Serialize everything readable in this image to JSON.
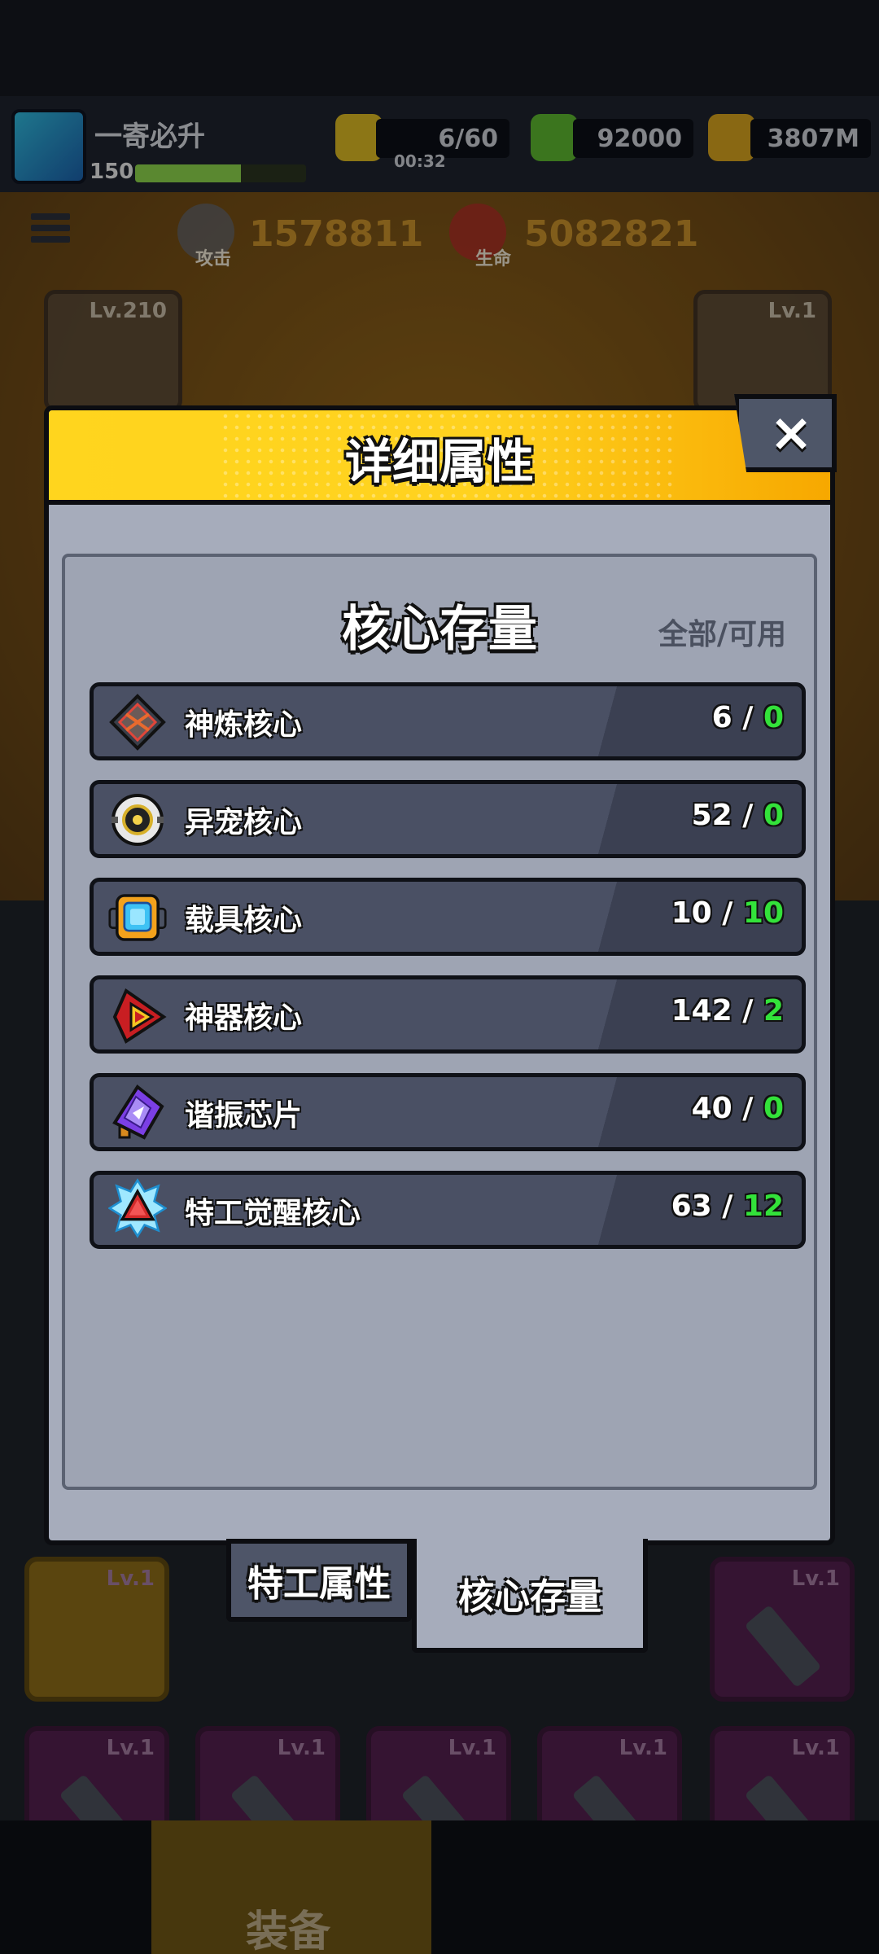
{
  "player": {
    "name": "一寄必升",
    "level": "150"
  },
  "resources": {
    "energy": "6/60",
    "energy_timer": "00:32",
    "gems": "92000",
    "gold": "3807M"
  },
  "stats": {
    "attack_label": "攻击",
    "attack_value": "1578811",
    "life_label": "生命",
    "life_value": "5082821"
  },
  "equip_cards": {
    "left_level": "Lv.210",
    "right_level": "Lv.1"
  },
  "slot_level": "Lv.1",
  "bottom_nav": {
    "active_label": "装备"
  },
  "modal": {
    "title": "详细属性",
    "close_label": "×",
    "panel_title": "核心存量",
    "hint": "全部/可用",
    "cores": [
      {
        "name": "神炼核心",
        "total": "6",
        "available": "0",
        "icon": "forge-core-icon"
      },
      {
        "name": "异宠核心",
        "total": "52",
        "available": "0",
        "icon": "pet-core-icon"
      },
      {
        "name": "载具核心",
        "total": "10",
        "available": "10",
        "icon": "vehicle-core-icon"
      },
      {
        "name": "神器核心",
        "total": "142",
        "available": "2",
        "icon": "artifact-core-icon"
      },
      {
        "name": "谐振芯片",
        "total": "40",
        "available": "0",
        "icon": "resonance-chip-icon"
      },
      {
        "name": "特工觉醒核心",
        "total": "63",
        "available": "12",
        "icon": "agent-awaken-core-icon"
      }
    ],
    "tabs": {
      "attributes": "特工属性",
      "cores": "核心存量"
    }
  },
  "colors": {
    "header_yellow": "#ffd51e",
    "available_green": "#33e23a",
    "row_bg": "#4a5064",
    "panel_bg": "#9ea4b3"
  }
}
